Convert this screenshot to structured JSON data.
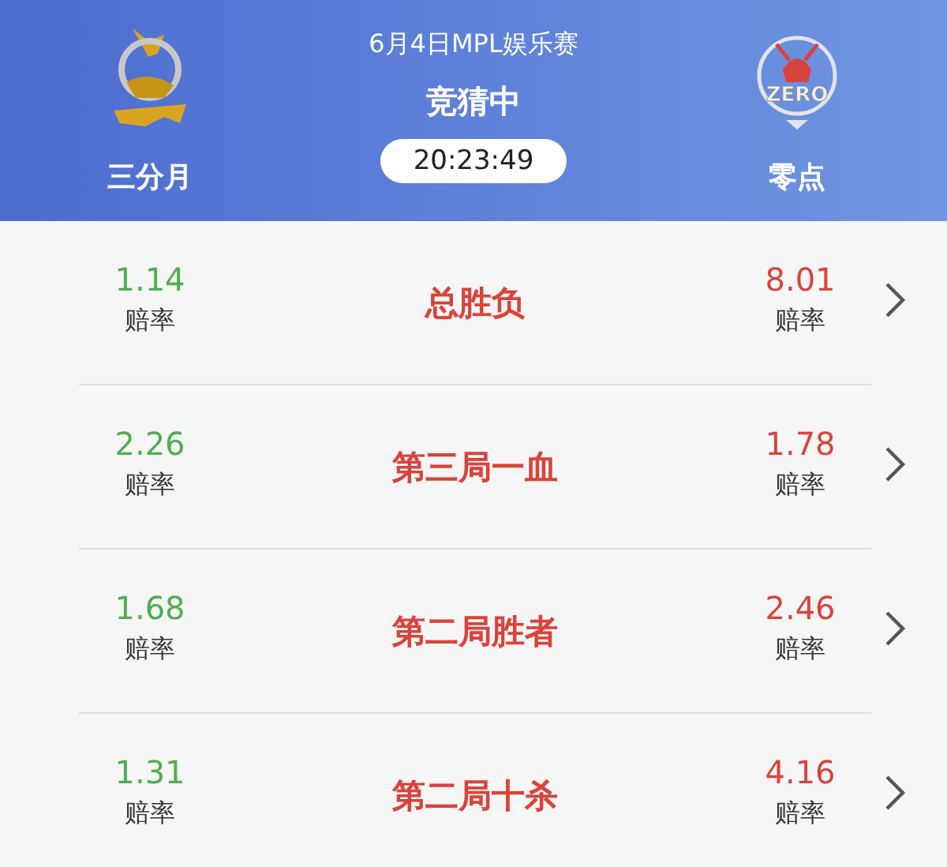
{
  "header": {
    "event": "6月4日MPL娱乐赛",
    "status": "竞猜中",
    "countdown": "20:23:49",
    "home": {
      "name": "三分月"
    },
    "away": {
      "name": "零点",
      "logo_text": "ZERO"
    }
  },
  "markets": [
    {
      "title": "总胜负",
      "home": {
        "odds": "1.14",
        "label": "赔率",
        "color": "#4caf50"
      },
      "away": {
        "odds": "8.01",
        "label": "赔率",
        "color": "#d9433b"
      }
    },
    {
      "title": "第三局一血",
      "home": {
        "odds": "2.26",
        "label": "赔率",
        "color": "#4caf50"
      },
      "away": {
        "odds": "1.78",
        "label": "赔率",
        "color": "#d9433b"
      }
    },
    {
      "title": "第二局胜者",
      "home": {
        "odds": "1.68",
        "label": "赔率",
        "color": "#4caf50"
      },
      "away": {
        "odds": "2.46",
        "label": "赔率",
        "color": "#d9433b"
      }
    },
    {
      "title": "第二局十杀",
      "home": {
        "odds": "1.31",
        "label": "赔率",
        "color": "#4caf50"
      },
      "away": {
        "odds": "4.16",
        "label": "赔率",
        "color": "#d9433b"
      }
    }
  ]
}
